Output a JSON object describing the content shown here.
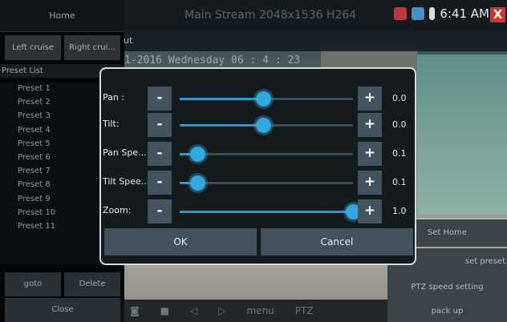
{
  "title_bar": {
    "stream_title": "Main Stream 2048x1536 H264",
    "clock": "6:41 AM",
    "close_label": "X"
  },
  "sub_bar": {
    "text": "ut"
  },
  "osd": {
    "text": "1-2016 Wednesday 06 : 4 : 23"
  },
  "left_panel": {
    "home_label": "Home",
    "left_cruise_label": "Left cruise",
    "right_cruise_label": "Right crui...",
    "preset_list_label": "Preset List",
    "presets": [
      "Preset 1",
      "Preset 2",
      "Preset 3",
      "Preset 4",
      "Preset 5",
      "Preset 6",
      "Preset 7",
      "Preset 8",
      "Preset 9",
      "Preset 10",
      "Preset 11"
    ],
    "goto_label": "goto",
    "delete_label": "Delete",
    "close_label": "Close"
  },
  "right_panel": {
    "set_home_label": "Set Home",
    "set_preset_label": "set preset",
    "ptz_speed_label": "PTZ speed setting",
    "pack_up_label": "pack up"
  },
  "bottom_bar": {
    "menu_label": "menu",
    "ptz_label": "PTZ"
  },
  "dialog": {
    "rows": [
      {
        "label": "Pan :",
        "value": "0.0",
        "level": 0.48
      },
      {
        "label": "Tilt:",
        "value": "0.0",
        "level": 0.48
      },
      {
        "label": "Pan Spe...",
        "value": "0.1",
        "level": 0.1
      },
      {
        "label": "Tilt Spee...",
        "value": "0.1",
        "level": 0.1
      },
      {
        "label": "Zoom:",
        "value": "1.0",
        "level": 1.0
      }
    ],
    "minus_label": "-",
    "plus_label": "+",
    "ok_label": "OK",
    "cancel_label": "Cancel"
  },
  "colors": {
    "accent": "#33a7e0",
    "close": "#d8322c"
  }
}
